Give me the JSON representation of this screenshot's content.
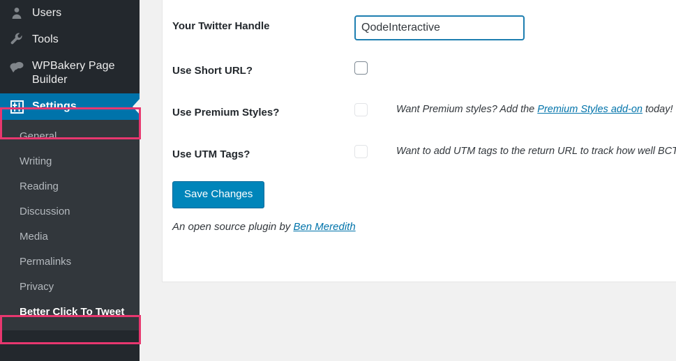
{
  "sidebar": {
    "items": [
      {
        "label": "Users",
        "icon": "users-icon",
        "current": false
      },
      {
        "label": "Tools",
        "icon": "wrench-icon",
        "current": false
      },
      {
        "label": "WPBakery Page Builder",
        "icon": "wpbakery-icon",
        "current": false
      },
      {
        "label": "Settings",
        "icon": "sliders-icon",
        "current": true
      }
    ],
    "submenu": [
      {
        "label": "General",
        "active": false
      },
      {
        "label": "Writing",
        "active": false
      },
      {
        "label": "Reading",
        "active": false
      },
      {
        "label": "Discussion",
        "active": false
      },
      {
        "label": "Media",
        "active": false
      },
      {
        "label": "Permalinks",
        "active": false
      },
      {
        "label": "Privacy",
        "active": false
      },
      {
        "label": "Better Click To Tweet",
        "active": true
      }
    ]
  },
  "form": {
    "rows": [
      {
        "label": "Your Twitter Handle",
        "type": "text",
        "value": "QodeInteractive",
        "placeholder": ""
      },
      {
        "label": "Use Short URL?",
        "type": "checkbox",
        "checked": false,
        "description": ""
      },
      {
        "label": "Use Premium Styles?",
        "type": "checkbox",
        "checked": false,
        "description_before": "Want Premium styles? Add the ",
        "description_link": "Premium Styles add-on",
        "description_after": " today!"
      },
      {
        "label": "Use UTM Tags?",
        "type": "checkbox",
        "checked": false,
        "description": "Want to add UTM tags to the return URL to track how well BCTT i"
      }
    ],
    "save_label": "Save Changes",
    "footer_before": "An open source plugin by ",
    "footer_link": "Ben Meredith"
  },
  "colors": {
    "sidebar_bg": "#23282d",
    "submenu_bg": "#32373c",
    "accent_blue": "#0073aa",
    "button_blue": "#0085ba",
    "annotation_pink": "#e8376f",
    "page_bg": "#f1f1f1"
  }
}
